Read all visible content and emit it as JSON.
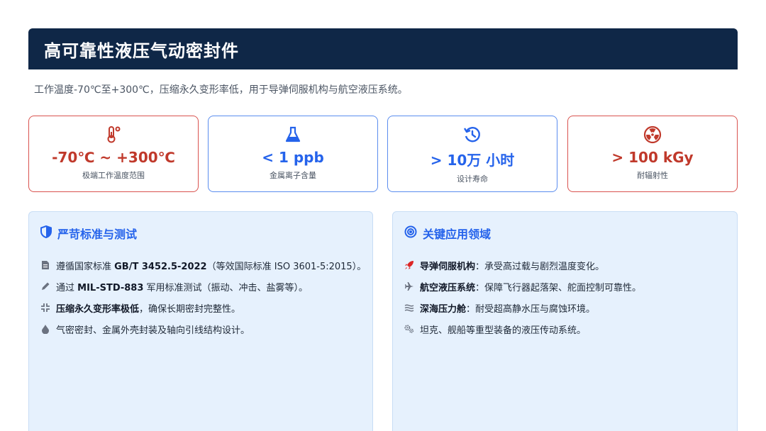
{
  "title": "高可靠性液压气动密封件",
  "subtitle": "工作温度-70℃至+300℃，压缩永久变形率低，用于导弹伺服机构与航空液压系统。",
  "stats": [
    {
      "icon": "thermometer-icon",
      "value": "-70℃ ~ +300℃",
      "label": "极端工作温度范围",
      "color": "#c0392b"
    },
    {
      "icon": "flask-icon",
      "value": "< 1 ppb",
      "label": "金属离子含量",
      "color": "#2563eb"
    },
    {
      "icon": "history-icon",
      "value": "> 10万 小时",
      "label": "设计寿命",
      "color": "#2563eb"
    },
    {
      "icon": "radiation-icon",
      "value": "> 100 kGy",
      "label": "耐辐射性",
      "color": "#c0392b"
    }
  ],
  "standards": {
    "title": "严苛标准与测试",
    "items": [
      {
        "icon": "document-icon",
        "pre": "遵循国家标准 ",
        "bold": "GB/T 3452.5-2022",
        "post": "（等效国际标准 ISO 3601-5:2015）。"
      },
      {
        "icon": "pencil-icon",
        "pre": "通过 ",
        "bold": "MIL-STD-883",
        "post": " 军用标准测试（振动、冲击、盐雾等）。"
      },
      {
        "icon": "compress-icon",
        "pre": "",
        "bold": "压缩永久变形率极低",
        "post": "，确保长期密封完整性。"
      },
      {
        "icon": "droplet-icon",
        "pre": "气密密封、金属外壳封装及轴向引线结构设计。",
        "bold": "",
        "post": ""
      }
    ]
  },
  "applications": {
    "title": "关键应用领域",
    "items": [
      {
        "icon": "rocket-icon",
        "pre": "",
        "bold": "导弹伺服机构",
        "post": "：承受高过载与剧烈温度变化。"
      },
      {
        "icon": "plane-icon",
        "pre": "",
        "bold": "航空液压系统",
        "post": "：保障飞行器起落架、舵面控制可靠性。"
      },
      {
        "icon": "water-icon",
        "pre": "",
        "bold": "深海压力舱",
        "post": "：耐受超高静水压与腐蚀环境。"
      },
      {
        "icon": "gears-icon",
        "pre": "坦克、舰船等重型装备的液压传动系统。",
        "bold": "",
        "post": ""
      }
    ]
  }
}
